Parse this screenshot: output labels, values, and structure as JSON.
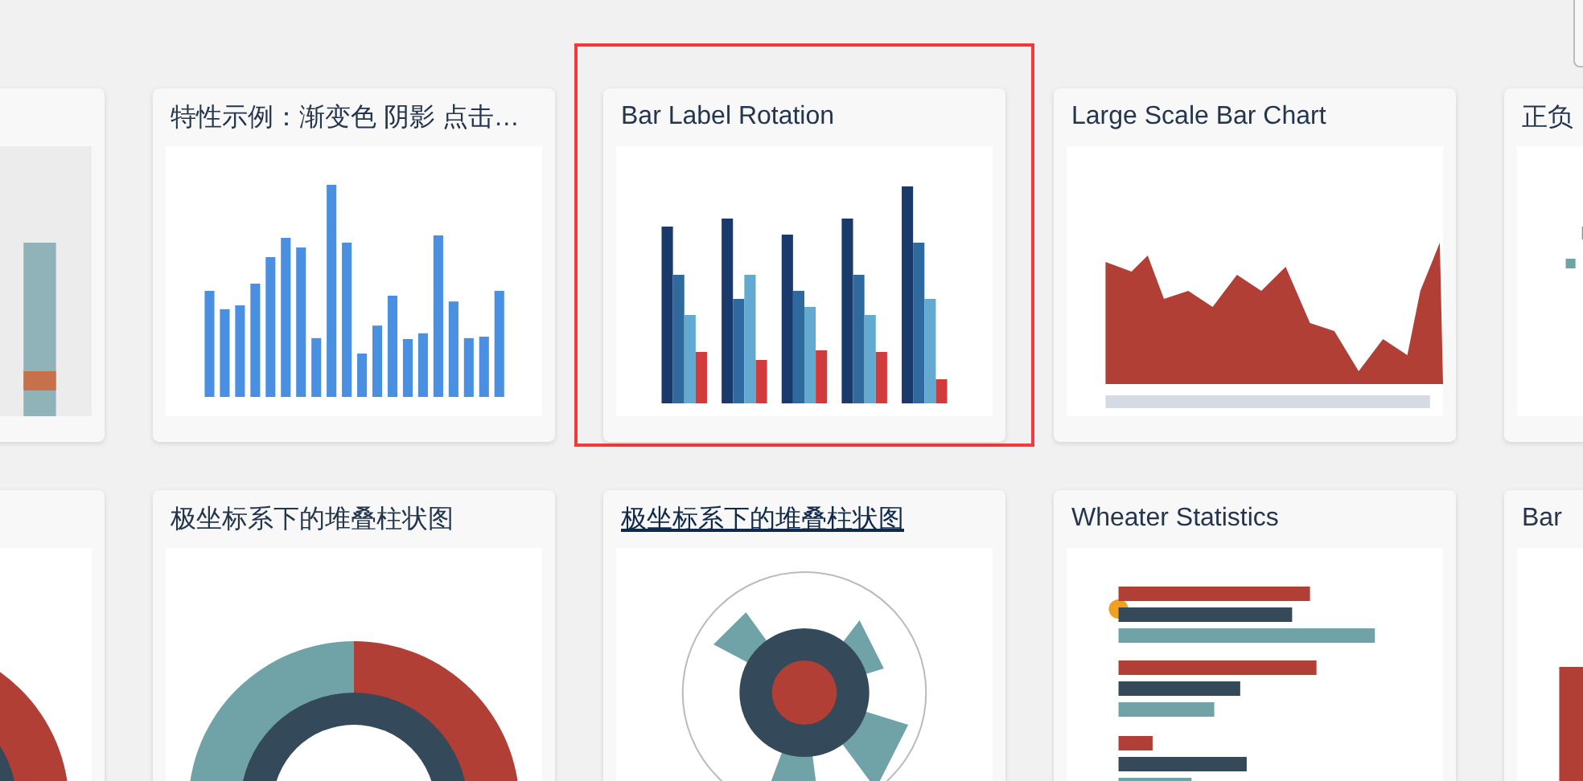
{
  "rows": [
    {
      "cards": [
        {
          "kind": "picture"
        },
        {
          "title": "特性示例：渐变色 阴影 点击…",
          "kind": "picture",
          "highlighted": false,
          "hovered": false
        },
        {
          "title": "Bar Label Rotation",
          "kind": "picture",
          "highlighted": true,
          "hovered": false
        },
        {
          "title": "Large Scale Bar Chart",
          "kind": "picture",
          "highlighted": false,
          "hovered": false
        },
        {
          "title": "正负",
          "kind": "picture",
          "highlighted": false,
          "hovered": false
        }
      ]
    },
    {
      "cards": [
        {
          "kind": "picture"
        },
        {
          "title": "极坐标系下的堆叠柱状图",
          "kind": "picture",
          "highlighted": false,
          "hovered": false
        },
        {
          "title": "极坐标系下的堆叠柱状图",
          "kind": "picture",
          "highlighted": false,
          "hovered": true
        },
        {
          "title": "Wheater Statistics",
          "kind": "picture",
          "highlighted": false,
          "hovered": false
        },
        {
          "title": "Bar",
          "kind": "picture",
          "highlighted": false,
          "hovered": false
        }
      ]
    }
  ]
}
